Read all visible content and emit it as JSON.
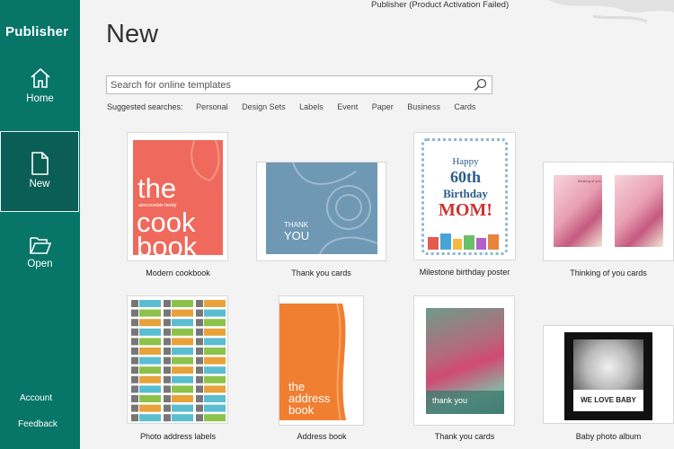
{
  "window": {
    "title": "Publisher (Product Activation Failed)"
  },
  "sidebar": {
    "app_title": "Publisher",
    "items": [
      {
        "label": "Home",
        "icon": "home-icon"
      },
      {
        "label": "New",
        "icon": "new-file-icon",
        "selected": true
      },
      {
        "label": "Open",
        "icon": "open-folder-icon"
      }
    ],
    "bottom_links": [
      {
        "label": "Account"
      },
      {
        "label": "Feedback"
      }
    ],
    "colors": {
      "background": "#077568",
      "selected": "#0b5e55"
    }
  },
  "main": {
    "title": "New",
    "search": {
      "placeholder": "Search for online templates",
      "value": ""
    },
    "suggested_label": "Suggested searches:",
    "suggested": [
      "Personal",
      "Design Sets",
      "Labels",
      "Event",
      "Paper",
      "Business",
      "Cards"
    ],
    "templates": [
      {
        "caption": "Modern cookbook",
        "thumb_text": {
          "line1": "the",
          "small": "abercrombie family",
          "line2": "cook",
          "line3": "book"
        }
      },
      {
        "caption": "Thank you cards",
        "thumb_text": {
          "line1": "THANK",
          "line2": "YOU"
        }
      },
      {
        "caption": "Milestone birthday poster",
        "thumb_text": {
          "line1": "Happy",
          "line2": "60th",
          "line3": "Birthday",
          "line4": "MOM!"
        }
      },
      {
        "caption": "Thinking of you cards",
        "thumb_text": {
          "small": "thinking of you"
        }
      },
      {
        "caption": "Photo address labels"
      },
      {
        "caption": "Address book",
        "thumb_text": {
          "line1": "the",
          "line2": "address",
          "line3": "book"
        }
      },
      {
        "caption": "Thank you cards",
        "thumb_text": {
          "line1": "thank you"
        }
      },
      {
        "caption": "Baby photo album",
        "thumb_text": {
          "line1": "WE LOVE BABY"
        }
      }
    ]
  }
}
